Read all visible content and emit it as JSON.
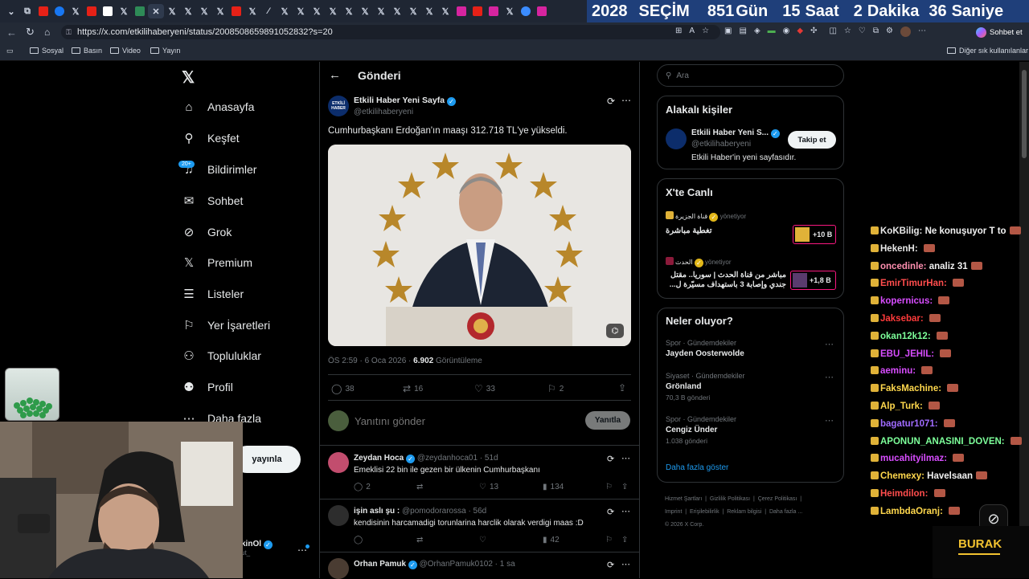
{
  "browser": {
    "url": "https://x.com/etkilihaberyeni/status/2008508659891052832?s=20",
    "countdown": {
      "year": "2028",
      "label": "SEÇİM",
      "days": "851",
      "days_unit": "Gün",
      "hours": "15",
      "hours_unit": "Saat",
      "minutes": "2",
      "minutes_unit": "Dakika",
      "seconds": "36",
      "seconds_unit": "Saniye"
    },
    "chat_button": "Sohbet et",
    "bookmarks": [
      "Sosyal",
      "Basın",
      "Video",
      "Yayın"
    ],
    "other_bookmarks": "Diğer sık kullanılanlar"
  },
  "nav": {
    "items": [
      {
        "label": "Anasayfa",
        "icon": "home-icon"
      },
      {
        "label": "Keşfet",
        "icon": "search-icon"
      },
      {
        "label": "Bildirimler",
        "icon": "bell-icon"
      },
      {
        "label": "Sohbet",
        "icon": "mail-icon"
      },
      {
        "label": "Grok",
        "icon": "grok-icon"
      },
      {
        "label": "Premium",
        "icon": "x-icon"
      },
      {
        "label": "Listeler",
        "icon": "list-icon"
      },
      {
        "label": "Yer İşaretleri",
        "icon": "bookmark-icon"
      },
      {
        "label": "Topluluklar",
        "icon": "community-icon"
      },
      {
        "label": "Profil",
        "icon": "profile-icon"
      },
      {
        "label": "Daha fazla",
        "icon": "more-icon"
      }
    ],
    "notification_badge": "20+",
    "post_button": "yayınla",
    "account_name": "kinOl",
    "account_handle": "ut_"
  },
  "post": {
    "header": "Gönderi",
    "author": "Etkili Haber Yeni Sayfa",
    "handle": "@etkilihaberyeni",
    "text": "Cumhurbaşkanı Erdoğan'ın maaşı 312.718 TL'ye yükseldi.",
    "time": "ÖS 2:59 · 6 Oca 2026 ·",
    "views": "6.902",
    "views_label": "Görüntüleme",
    "replies": "38",
    "reposts": "16",
    "likes": "33",
    "bookmarks": "2",
    "reply_placeholder": "Yanıtını gönder",
    "reply_button": "Yanıtla",
    "avatar_text": "ETKİLİ HABER"
  },
  "replies": [
    {
      "name": "Zeydan Hoca",
      "handle": "@zeydanhoca01 · 51d",
      "text": "Emeklisi 22 bin ile gezen bir ülkenin Cumhurbaşkanı",
      "replies": "2",
      "likes": "13",
      "views": "134"
    },
    {
      "name": "işin aslı şu :",
      "handle": "@pomodorarossa · 56d",
      "text": "kendisinin harcamadigi torunlarina harclik olarak verdigi maas :D",
      "replies": "",
      "likes": "",
      "views": "42"
    },
    {
      "name": "Orhan Pamuk",
      "handle": "@OrhanPamuk0102 · 1 sa",
      "text": ""
    }
  ],
  "right": {
    "search_placeholder": "Ara",
    "related_title": "Alakalı kişiler",
    "related_name": "Etkili Haber Yeni S...",
    "related_handle": "@etkilihaberyeni",
    "related_bio": "Etkili Haber'in yeni sayfasıdır.",
    "follow_button": "Takip et",
    "live_title": "X'te Canlı",
    "live": [
      {
        "channel": "قناة الجزيرة",
        "status": "yönetiyor",
        "title": "تغطية مباشرة",
        "count": "+10 B"
      },
      {
        "channel": "الحدث",
        "status": "yönetiyor",
        "title": "مباشر من قناة الحدث | سوريا.. مقتل جندي وإصابة 3 باستهداف مسيّرة ل...",
        "count": "+1,8 B"
      }
    ],
    "trends_title": "Neler oluyor?",
    "trends": [
      {
        "meta": "Spor · Gündemdekiler",
        "title": "Jayden Oosterwolde",
        "count": ""
      },
      {
        "meta": "Siyaset · Gündemdekiler",
        "title": "Grönland",
        "count": "70,3 B gönderi"
      },
      {
        "meta": "Spor · Gündemdekiler",
        "title": "Cengiz Ünder",
        "count": "1.038 gönderi"
      }
    ],
    "show_more": "Daha fazla göster",
    "footer": [
      "Hizmet Şartları",
      "Gizlilik Politikası",
      "Çerez Politikası",
      "Imprint",
      "Erişilebilirlik",
      "Reklam bilgisi",
      "Daha fazla ...",
      "© 2026 X Corp."
    ]
  },
  "stream_chat": [
    {
      "user": "KoKBilig:",
      "msg": "Ne konuşuyor T to",
      "color": "#e8e8e8"
    },
    {
      "user": "HekenH:",
      "msg": "",
      "color": "#e8e8e8"
    },
    {
      "user": "oncedinle:",
      "msg": "analiz 31",
      "color": "#ff8fb0"
    },
    {
      "user": "EmirTimurHan:",
      "msg": "",
      "color": "#ff4d4d"
    },
    {
      "user": "kopernicus:",
      "msg": "",
      "color": "#d84dff"
    },
    {
      "user": "Jaksebar:",
      "msg": "",
      "color": "#ff3b3b"
    },
    {
      "user": "okan12k12:",
      "msg": "",
      "color": "#7dff9a"
    },
    {
      "user": "EBU_JEHIL:",
      "msg": "",
      "color": "#d84dff"
    },
    {
      "user": "aeminu:",
      "msg": "",
      "color": "#d84dff"
    },
    {
      "user": "FaksMachine:",
      "msg": "",
      "color": "#ffd84d"
    },
    {
      "user": "Alp_Turk:",
      "msg": "",
      "color": "#ffd84d"
    },
    {
      "user": "bagatur1071:",
      "msg": "",
      "color": "#a06bff"
    },
    {
      "user": "APONUN_ANASINI_DOVEN:",
      "msg": "",
      "color": "#7dff9a"
    },
    {
      "user": "mucahityilmaz:",
      "msg": "",
      "color": "#d84dff"
    },
    {
      "user": "Chemexy:",
      "msg": "Havelsaan",
      "color": "#ffd84d"
    },
    {
      "user": "Heimdilon:",
      "msg": "",
      "color": "#ff4d4d"
    },
    {
      "user": "LambdaOranj:",
      "msg": "",
      "color": "#ffd84d"
    }
  ],
  "streamer_name": "BURAK"
}
